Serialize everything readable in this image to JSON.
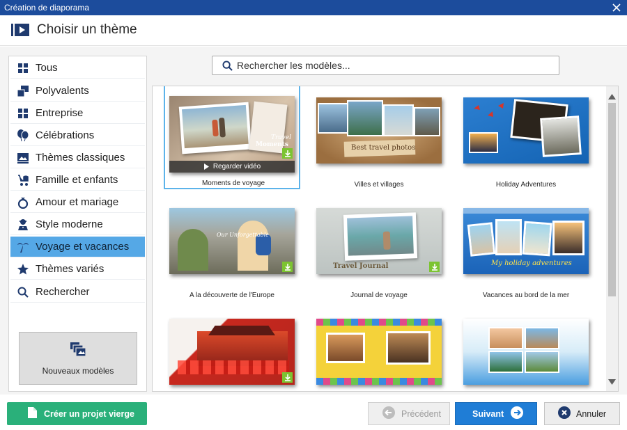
{
  "window": {
    "title": "Création de diaporama"
  },
  "header": {
    "title": "Choisir un thème"
  },
  "search": {
    "placeholder": "Rechercher les modèles..."
  },
  "sidebar": {
    "items": [
      {
        "label": "Tous",
        "icon": "grid-icon"
      },
      {
        "label": "Polyvalents",
        "icon": "stack-icon"
      },
      {
        "label": "Entreprise",
        "icon": "grid-icon"
      },
      {
        "label": "Célébrations",
        "icon": "balloons-icon"
      },
      {
        "label": "Thèmes classiques",
        "icon": "frame-icon"
      },
      {
        "label": "Famille et enfants",
        "icon": "stroller-icon"
      },
      {
        "label": "Amour et mariage",
        "icon": "rings-icon"
      },
      {
        "label": "Style moderne",
        "icon": "person-icon"
      },
      {
        "label": "Voyage et vacances",
        "icon": "palm-icon",
        "selected": true
      },
      {
        "label": "Thèmes variés",
        "icon": "star-icon"
      },
      {
        "label": "Rechercher",
        "icon": "search-icon"
      }
    ],
    "new_models_label": "Nouveaux modèles"
  },
  "themes": [
    {
      "caption": "Moments de voyage",
      "selected": true,
      "download": true,
      "watch_label": "Regarder vidéo",
      "thumb_text": [
        "Travel",
        "Moments"
      ]
    },
    {
      "caption": "Villes et villages",
      "download": false,
      "thumb_text": [
        "Best travel photos"
      ]
    },
    {
      "caption": "Holiday Adventures",
      "download": false
    },
    {
      "caption": "A la découverte de l'Europe",
      "download": true,
      "thumb_text": [
        "Our Unforgettable"
      ]
    },
    {
      "caption": "Journal de voyage",
      "download": true,
      "thumb_text": [
        "Travel Journal"
      ]
    },
    {
      "caption": "Vacances au bord de la mer",
      "download": false,
      "thumb_text": [
        "My holiday adventures"
      ]
    },
    {
      "caption": "",
      "download": true
    },
    {
      "caption": "",
      "download": false
    },
    {
      "caption": "",
      "download": false
    }
  ],
  "footer": {
    "create_label": "Créer un projet vierge",
    "prev_label": "Précédent",
    "next_label": "Suivant",
    "cancel_label": "Annuler"
  },
  "colors": {
    "titlebar": "#1c4c9c",
    "selection": "#55a8e6",
    "create_button": "#2ab07a",
    "next_button": "#1f7dd6",
    "download_badge": "#7cc431"
  }
}
